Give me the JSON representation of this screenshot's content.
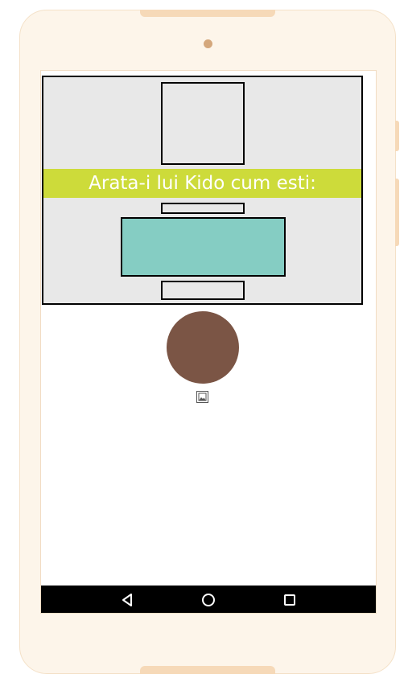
{
  "prompt": {
    "text": "Arata-i lui Kido cum esti:"
  },
  "colors": {
    "device_frame": "#fdf5ea",
    "panel_background": "#e8e8e8",
    "title_strip": "#cddb3a",
    "teal_box": "#85cdc3",
    "avatar_circle": "#7b5545",
    "navbar": "#000000"
  },
  "icons": {
    "image_placeholder": "image-icon",
    "back": "back-triangle-icon",
    "home": "home-circle-icon",
    "recents": "recents-square-icon"
  }
}
